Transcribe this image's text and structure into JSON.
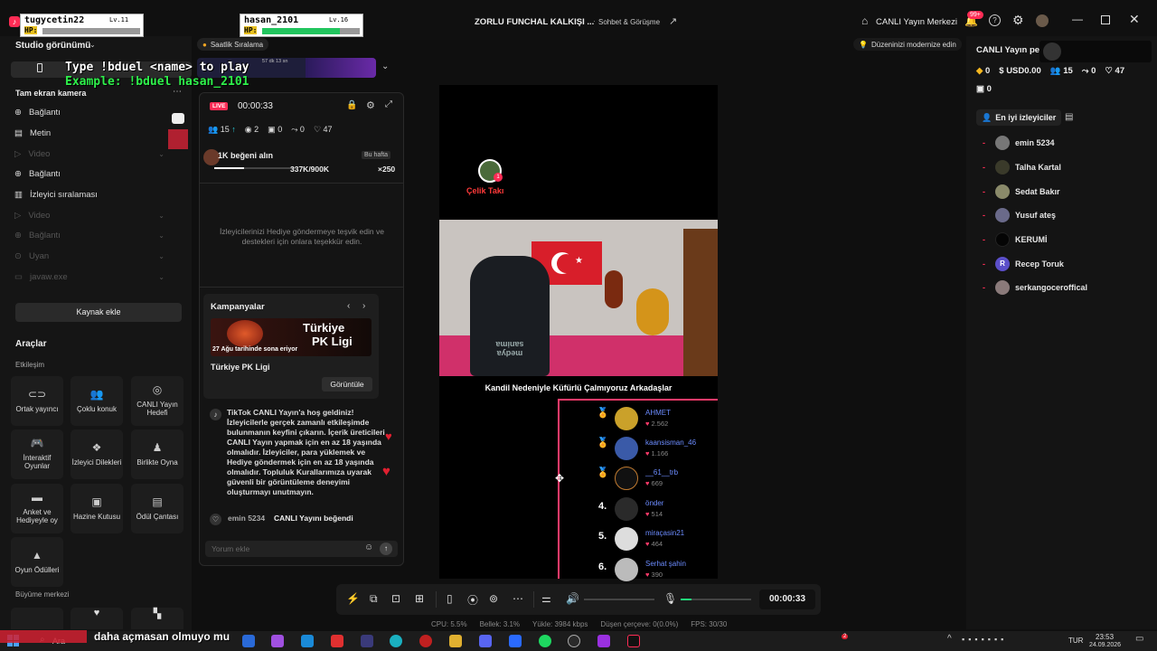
{
  "titlebar": {
    "stream_title": "ZORLU FUNCHAL KALKIŞI ...",
    "chat_label": "Sohbet & Görüşme",
    "live_center": "CANLI Yayın Merkezi",
    "notif_badge": "99+"
  },
  "game_overlay": {
    "p1_name": "tugycetin22",
    "p1_level": "Lv.11",
    "p1_hp": "HP:",
    "p2_name": "hasan_2101",
    "p2_level": "Lv.16",
    "p2_hp": "HP:",
    "instruction": "Type !bduel <name> to play",
    "example": "Example: !bduel hasan_2101",
    "hourly_ranking": "Saatlik Sıralama",
    "mini_info": "57 dk 13 sn"
  },
  "left_panel": {
    "studio_view": "Studio görünümü",
    "fullscreen_camera": "Tam ekran kamera",
    "sources": [
      {
        "label": "Bağlantı",
        "dim": false
      },
      {
        "label": "Metin",
        "dim": false
      },
      {
        "label": "Video",
        "dim": true
      },
      {
        "label": "Bağlantı",
        "dim": false
      },
      {
        "label": "İzleyici sıralaması",
        "dim": false
      },
      {
        "label": "Video",
        "dim": true
      },
      {
        "label": "Bağlantı",
        "dim": true
      },
      {
        "label": "Uyan",
        "dim": true
      },
      {
        "label": "javaw.exe",
        "dim": true
      }
    ],
    "add_source": "Kaynak ekle",
    "tools_title": "Araçlar",
    "interaction_title": "Etkileşim",
    "tools": [
      {
        "label": "Ortak yayıncı",
        "icon": "link-icon",
        "glyph": "⊂⊃"
      },
      {
        "label": "Çoklu konuk",
        "icon": "guests-icon",
        "glyph": "👥"
      },
      {
        "label": "CANLI Yayın Hedefi",
        "icon": "target-icon",
        "glyph": "◎"
      },
      {
        "label": "İnteraktif Oyunlar",
        "icon": "gamepad-icon",
        "glyph": "🎮"
      },
      {
        "label": "İzleyici Dilekleri",
        "icon": "gift-icon",
        "glyph": "❖"
      },
      {
        "label": "Birlikte Oyna",
        "icon": "play-together-icon",
        "glyph": "♟"
      },
      {
        "label": "Anket ve Hediyeyle oy",
        "icon": "poll-icon",
        "glyph": "▬"
      },
      {
        "label": "Hazine Kutusu",
        "icon": "treasure-icon",
        "glyph": "▣"
      },
      {
        "label": "Ödül Çantası",
        "icon": "reward-bag-icon",
        "glyph": "▤"
      },
      {
        "label": "Oyun Ödülleri",
        "icon": "game-reward-icon",
        "glyph": "▲"
      }
    ],
    "growth_title": "Büyüme merkezi"
  },
  "chat": {
    "live_badge": "LIVE",
    "timer": "00:00:33",
    "stats": {
      "viewers": "15",
      "eye": "2",
      "gifts": "0",
      "shares": "0",
      "likes": "47"
    },
    "goal_title": "1K beğeni alın",
    "goal_period": "Bu hafta",
    "goal_progress": "337K/900K",
    "goal_multiplier": "×250",
    "goal_fill": 0.37,
    "gift_prompt": "İzleyicilerinizi Hediye göndermeye teşvik edin ve destekleri için onlara teşekkür edin.",
    "campaigns_title": "Kampanyalar",
    "campaign_banner_line1": "Türkiye",
    "campaign_banner_line2": "PK Ligi",
    "campaign_end": "27 Ağu tarihinde sona eriyor",
    "campaign_name": "Türkiye PK Ligi",
    "view_button": "Görüntüle",
    "welcome": "TikTok CANLI Yayın'a hoş geldiniz! İzleyicilerle gerçek zamanlı etkileşimde bulunmanın keyfini çıkarın. İçerik üreticileri CANLI Yayın yapmak için en az 18 yaşında olmalıdır. İzleyiciler, para yüklemek ve Hediye göndermek için en az 18 yaşında olmalıdır. Topluluk Kurallarımıza uyarak güvenli bir görüntüleme deneyimi oluşturmayı unutmayın.",
    "like_user": "emin 5234",
    "like_text": "CANLI Yayını beğendi",
    "comment_placeholder": "Yorum ekle"
  },
  "preview": {
    "top_name": "Çelik Takı",
    "caption": "Kandil Nedeniyle Küfürlü Çalmıyoruz Arkadaşlar",
    "chair_text": "medya sanima",
    "leaderboard": [
      {
        "rank": "1",
        "name": "AHMET",
        "value": "2.562",
        "color": "#caa12a"
      },
      {
        "rank": "2",
        "name": "kaansisman_46",
        "value": "1.166",
        "color": "#3a5aa8"
      },
      {
        "rank": "3",
        "name": "__61__trb",
        "value": "669",
        "color": "#222"
      },
      {
        "rank": "4.",
        "name": "önder",
        "value": "514",
        "color": "#333"
      },
      {
        "rank": "5.",
        "name": "miraçasin21",
        "value": "464",
        "color": "#ddd"
      },
      {
        "rank": "6.",
        "name": "Serhat şahin",
        "value": "390",
        "color": "#bbb"
      }
    ]
  },
  "tip_bar": {
    "text": "Düzeninizi modernize edin"
  },
  "right_panel": {
    "title": "CANLI Yayın pe",
    "coins": "0",
    "usd": "USD0.00",
    "viewers": "15",
    "shares": "0",
    "likes": "47",
    "gifts": "0",
    "top_viewers_title": "En iyi izleyiciler",
    "viewers_list": [
      {
        "name": "emin 5234",
        "color": "#777"
      },
      {
        "name": "Talha Kartal",
        "color": "#3a3a2a"
      },
      {
        "name": "Sedat Bakır",
        "color": "#8a8a6a"
      },
      {
        "name": "Yusuf ateş",
        "color": "#6a6a8a"
      },
      {
        "name": "KERUMİ",
        "color": "#050505"
      },
      {
        "name": "Recep Toruk",
        "color": "#5b4fc9"
      },
      {
        "name": "serkangoceroffical",
        "color": "#8a7a7a"
      }
    ]
  },
  "toolbar": {
    "timer": "00:00:33"
  },
  "status": {
    "cpu": "CPU: 5.5%",
    "memory": "Bellek: 3.1%",
    "upload": "Yükle: 3984 kbps",
    "dropped": "Düşen çerçeve: 0(0.0%)",
    "fps": "FPS: 30/30"
  },
  "taskbar": {
    "search": "Ara",
    "overlay_text": "daha açmasan olmuyo mu",
    "language": "TUR",
    "time": "23:53",
    "date": "24.09.2026"
  }
}
